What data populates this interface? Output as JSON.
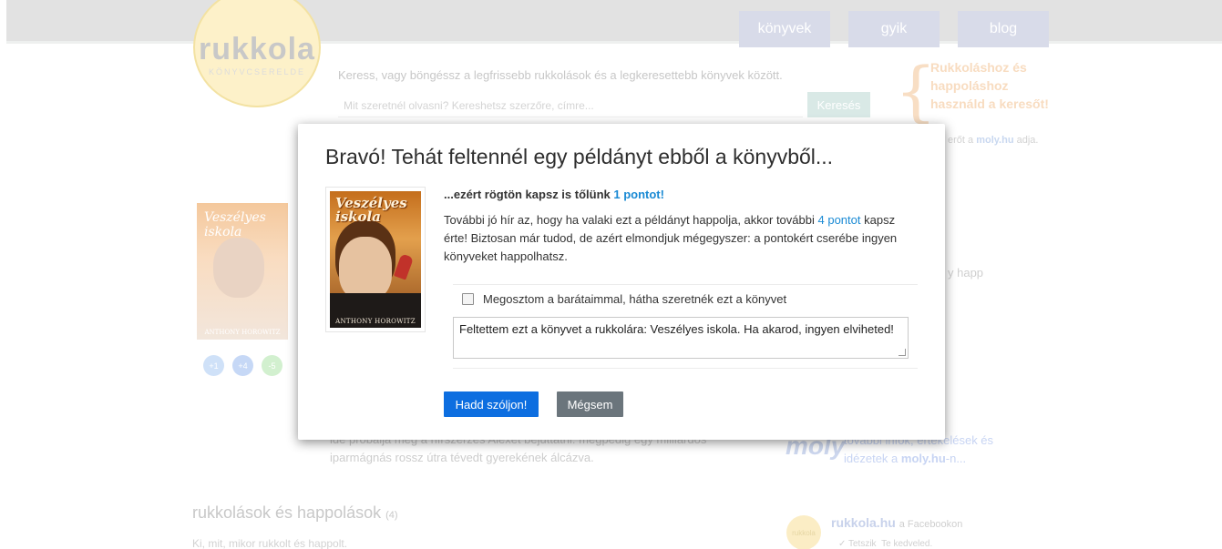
{
  "logo": {
    "word": "rukkola",
    "sub": "KÖNYVCSERELDE"
  },
  "nav": [
    {
      "label": "könyvek"
    },
    {
      "label": "gyik"
    },
    {
      "label": "blog"
    }
  ],
  "intro": "Keress, vagy böngéssz a legfrissebb rukkolások és a legkeresettebb könyvek között.",
  "search": {
    "placeholder": "Mit szeretnél olvasni? Kereshetsz szerzőre, címre...",
    "button": "Keresés"
  },
  "promo": {
    "text": "Rukkoláshoz és happoláshoz használd a keresőt!",
    "sub_prefix": "erőt a",
    "sub_link": "moly.hu",
    "sub_suffix": "adja."
  },
  "bg_book": {
    "title": "Veszélyes iskola",
    "author": "ANTHONY HOROWITZ"
  },
  "bg_badges": [
    "+1",
    "+4",
    "-5"
  ],
  "bg_happ": "y happ",
  "bg_desc": "ide próbálja meg a hírszerzés Alexet bejuttatni: megpedig egy milliárdos iparmágnás rossz útra tévedt gyerekének álcázva.",
  "moly": {
    "logo": "moly",
    "text_1": "további infók, értékelések és idézetek a",
    "link": "moly.hu",
    "text_2": "-n..."
  },
  "section": {
    "title": "rukkolások és happolások",
    "count": "(4)",
    "sub": "Ki, mit, mikor rukkolt és happolt."
  },
  "facebook": {
    "avatar": "rukkola",
    "name": "rukkola.hu",
    "on": "a Facebookon",
    "like": "✓ Tetszik",
    "liked": "Te kedveled."
  },
  "modal": {
    "title": "Bravó! Tehát feltennél egy példányt ebből a könyvből...",
    "cover_title": "Veszélyes iskola",
    "cover_author": "ANTHONY HOROWITZ",
    "lead_text": "...ezért rögtön kapsz is tőlünk",
    "lead_points": "1 pontot!",
    "desc_1": "További jó hír az, hogy ha valaki ezt a példányt happolja, akkor további",
    "desc_points": "4 pontot",
    "desc_2": "kapsz érte! Biztosan már tudod, de azért elmondjuk mégegyszer: a pontokért cserébe ingyen könyveket happolhatsz.",
    "share_label": "Megosztom a barátaimmal, hátha szeretnék ezt a könyvet",
    "share_text": "Feltettem ezt a könyvet a rukkolára: Veszélyes iskola. Ha akarod, ingyen elviheted!",
    "ok_button": "Hadd szóljon!",
    "cancel_button": "Mégsem"
  }
}
